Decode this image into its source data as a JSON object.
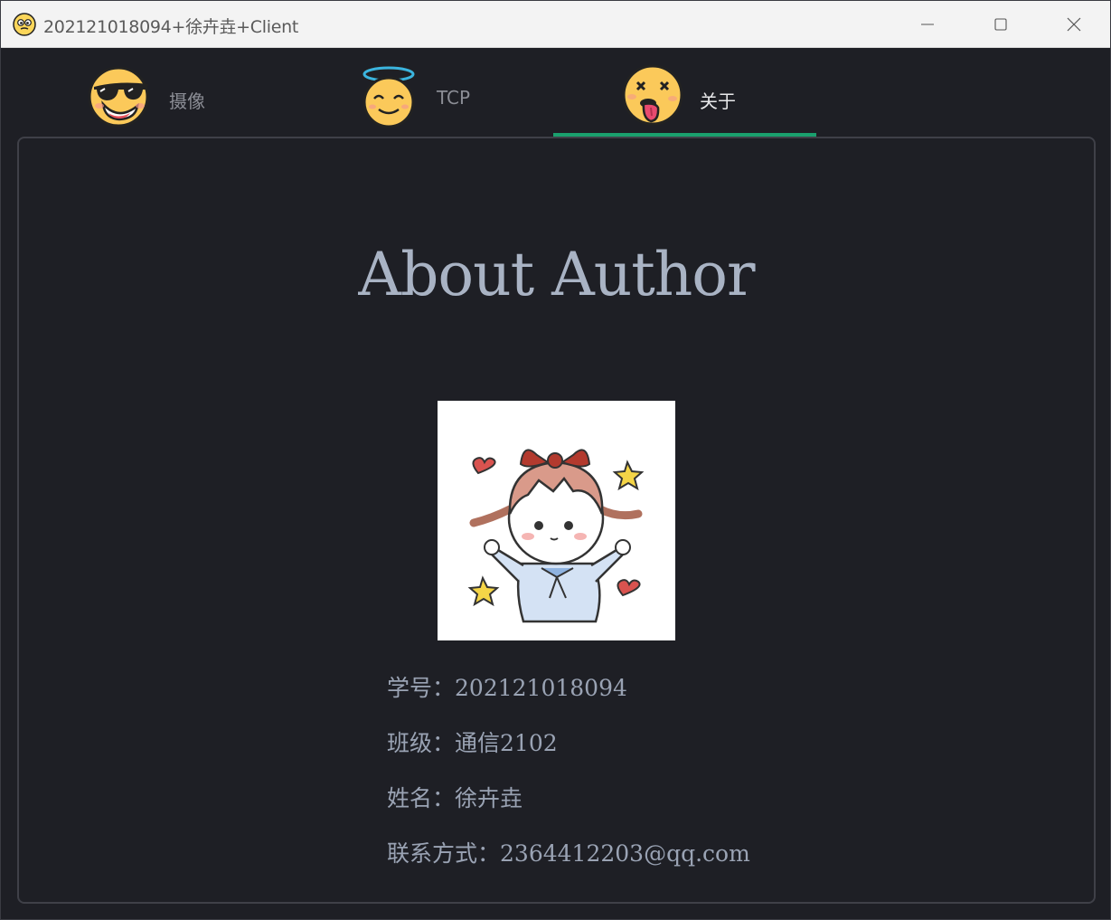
{
  "window": {
    "title": "202121018094+徐卉垚+Client",
    "controls": {
      "minimize": "minimize-icon",
      "maximize": "maximize-icon",
      "close": "close-icon"
    }
  },
  "tabs": [
    {
      "label": "摄像",
      "icon": "sunglasses-emoji-icon",
      "active": false
    },
    {
      "label": "TCP",
      "icon": "halo-emoji-icon",
      "active": false
    },
    {
      "label": "关于",
      "icon": "dizzy-tongue-emoji-icon",
      "active": true
    }
  ],
  "about": {
    "heading": "About Author",
    "avatar": "cartoon-girl-avatar",
    "fields": [
      {
        "label": "学号：",
        "value": "202121018094"
      },
      {
        "label": "班级：",
        "value": "通信2102"
      },
      {
        "label": "姓名：",
        "value": "徐卉垚"
      },
      {
        "label": "联系方式：",
        "value": "2364412203@qq.com"
      }
    ]
  },
  "colors": {
    "background": "#1e1f25",
    "accent": "#1aa06e",
    "heading": "#a9b3c4",
    "text": "#9aa3b4"
  }
}
